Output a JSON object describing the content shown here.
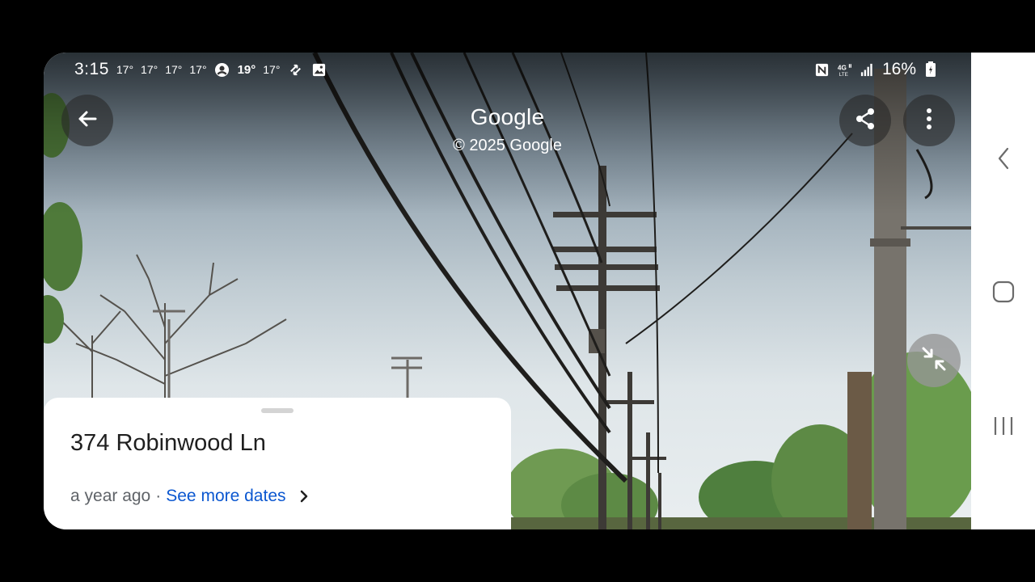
{
  "status_bar": {
    "time": "3:15",
    "temps": [
      "17°",
      "17°",
      "17°",
      "17°"
    ],
    "temp_bold": "19°",
    "temp_after": "17°",
    "battery": "16%",
    "icons": [
      "account-circle-icon",
      "sync-icon",
      "image-icon",
      "nfc-icon",
      "4g-lte-icon",
      "signal-icon",
      "battery-charging-icon"
    ]
  },
  "header": {
    "title": "Google",
    "copyright": "© 2025 Google",
    "back_icon": "arrow-back-icon",
    "share_icon": "share-icon",
    "more_icon": "more-vert-icon"
  },
  "exit_fullscreen_icon": "collapse-icon",
  "card": {
    "address": "374 Robinwood Ln",
    "date": "a year ago",
    "separator": "·",
    "more_dates_label": "See more dates"
  },
  "nav_bar": {
    "icons": [
      "nav-back-icon",
      "nav-home-icon",
      "nav-recents-icon"
    ]
  }
}
